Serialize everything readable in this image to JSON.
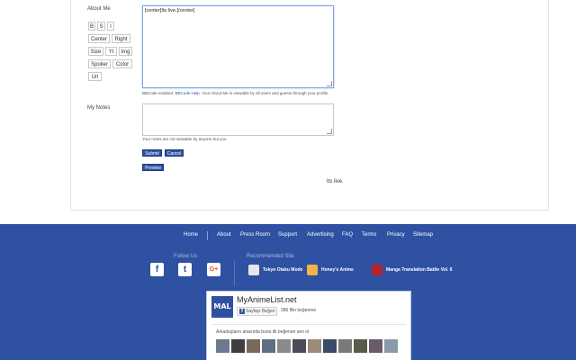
{
  "profile": {
    "about_label": "About Me",
    "about_text": "[center]Its live.[/center]",
    "bbcode_buttons": [
      [
        "B",
        "S",
        "I"
      ],
      [
        "Center",
        "Right"
      ],
      [
        "Size",
        "Yt",
        "Img"
      ],
      [
        "Spoiler",
        "Color"
      ],
      [
        "Url"
      ]
    ],
    "bbcode_hint": {
      "before": "BBCode enabled. ",
      "link": "BBCode Help",
      "after": ". Your About Me is viewable by all users and guests through your profile."
    },
    "notes_label": "My Notes",
    "notes_text": "",
    "notes_hint": "Your notes are not viewable by anyone but you.",
    "submit_label": "Submit",
    "cancel_label": "Cancel",
    "preview_label": "Preview",
    "preview_output": "Its live."
  },
  "footer": {
    "nav": [
      "Home",
      "About",
      "Press Room",
      "Support",
      "Advertising",
      "FAQ",
      "Terms",
      "Privacy",
      "Sitemap"
    ],
    "follow_us_label": "Follow Us",
    "social": [
      {
        "icon": "facebook-icon",
        "glyph": "f",
        "color": "#ffffff",
        "fg": "#2e51a2"
      },
      {
        "icon": "twitter-icon",
        "glyph": "t",
        "color": "#ffffff",
        "fg": "#2e51a2"
      },
      {
        "icon": "google-plus-icon",
        "glyph": "G+",
        "color": "#ffffff",
        "fg": "#dd4b39"
      }
    ],
    "recommended_label": "Recommended Site",
    "recommended": [
      {
        "label": "Tokyo Otaku Mode",
        "icon": "tokyo-otaku-mode-icon",
        "color": "#e7e7e7"
      },
      {
        "label": "Honey's Anime",
        "icon": "honeys-anime-icon",
        "color": "#f2b347"
      },
      {
        "label": "Manga Translation Battle Vol. 6",
        "icon": "manga-translation-battle-icon",
        "color": "#b8242b"
      }
    ],
    "fb_widget": {
      "logo_text": "MAL",
      "page_name": "MyAnimeList.net",
      "like_button": "Sayfayı Beğen",
      "like_count": "286 Bin beğenme",
      "friends_text": "Arkadaşların arasında bunu ilk beğenen sen ol",
      "avatar_colors": [
        "#6b7a8f",
        "#3f3f3f",
        "#7a6a5a",
        "#5e6f85",
        "#8a8a8a",
        "#4a4a5a",
        "#9a8a7a",
        "#3a4a6a",
        "#7a7a7a",
        "#5a5a4a",
        "#6a5a6a",
        "#8a9aaa"
      ]
    }
  },
  "colors": {
    "brand_blue": "#2e51a2",
    "link_blue": "#2e51a2"
  }
}
